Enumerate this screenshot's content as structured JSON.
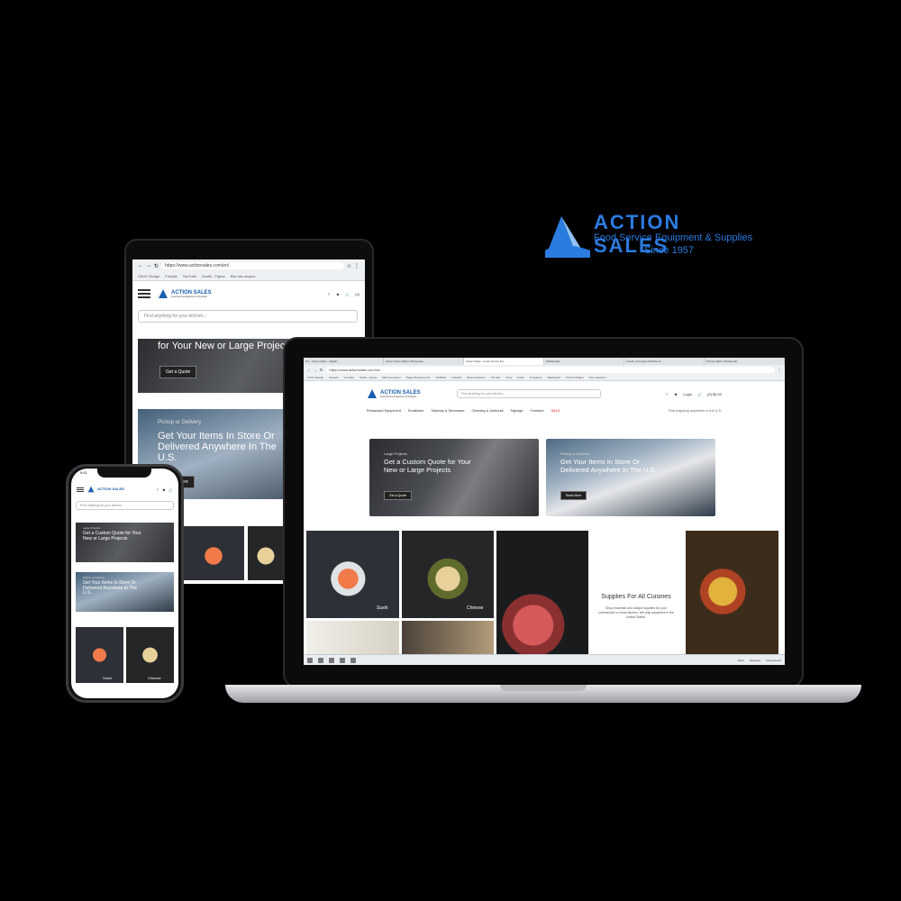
{
  "brand": {
    "name": "ACTION SALES",
    "tagline": "Food Service Equipment & Supplies",
    "since": "Since 1957"
  },
  "laptop": {
    "tabs": [
      "Pro - Action Sales - Digital...",
      "Action Sales (Main) Workspace...",
      "Action Sales - Food Service Eq...",
      "Whiteboard",
      "Leads | Complete Website Is...",
      "Pricing Matrix (Old Email)"
    ],
    "url": "https://www.actionsales.com/en/",
    "bookmarks": [
      "UI/UX Design",
      "Freepik",
      "YouTube",
      "Drafts - Figma",
      "SEO Generator",
      "Pages Business Lib.",
      "Dribbble",
      "LinkedIn",
      "Best Freelance",
      "UX Hub",
      "Tools",
      "Fonts",
      "Templates",
      "Dashboard",
      "Pixel & Widget",
      "Tips collection"
    ],
    "search_placeholder": "Find anything for your kitchen...",
    "login": "Login",
    "cart": "(0) $0.00",
    "nav": [
      "Restaurant Equipment",
      "Smallware",
      "Tabletop & Serveware",
      "Cleaning & Janitorial",
      "Signage",
      "Furniture",
      "SALE"
    ],
    "ship_note": "Fast shipping anywhere in the U.S.",
    "hero1": {
      "kicker": "Large Projects",
      "title": "Get a Custom Quote for Your New or Large Projects",
      "button": "Get a Quote"
    },
    "hero2": {
      "kicker": "Pickup or Delivery",
      "title": "Get Your Items In Store Or Delivered Anywhere In The U.S.",
      "button": "Read More"
    },
    "tiles": {
      "sushi": "Sushi",
      "chinese": "Chinese"
    },
    "cuisines_title": "Supplies For All Cuisines",
    "cuisines_text": "Shop essential and unique supplies for your commercial or home kitchen. We ship anywhere in the United States.",
    "taskbar": [
      "Work",
      "Weekday",
      "Dreamboard"
    ]
  },
  "tablet": {
    "url": "https://www.actionsales.com/en/",
    "bookmarks": [
      "UI/UX Design",
      "Freepik",
      "YouTube",
      "Drafts - Figma",
      "Rec sec-seguro"
    ],
    "search_placeholder": "Find anything for your kitchen...",
    "cart": "(0)",
    "hero1_title": "for Your New or Large Projects",
    "hero1_button": "Get a Quote",
    "hero2_kicker": "Pickup or Delivery",
    "hero2_title": "Get Your Items In Store Or Delivered Anywhere In The U.S.",
    "hero2_button": "Read More"
  },
  "phone": {
    "time": "9:41",
    "search_placeholder": "Find anything for your kitchen...",
    "hero1_kicker": "Large Projects",
    "hero1_title": "Get a Custom Quote for Your New or Large Projects",
    "hero2_kicker": "Pickup or Delivery",
    "hero2_title": "Get Your Items In Store Or Delivered Anywhere In The U.S.",
    "tile_sushi": "Sushi",
    "tile_chinese": "Chinese"
  }
}
